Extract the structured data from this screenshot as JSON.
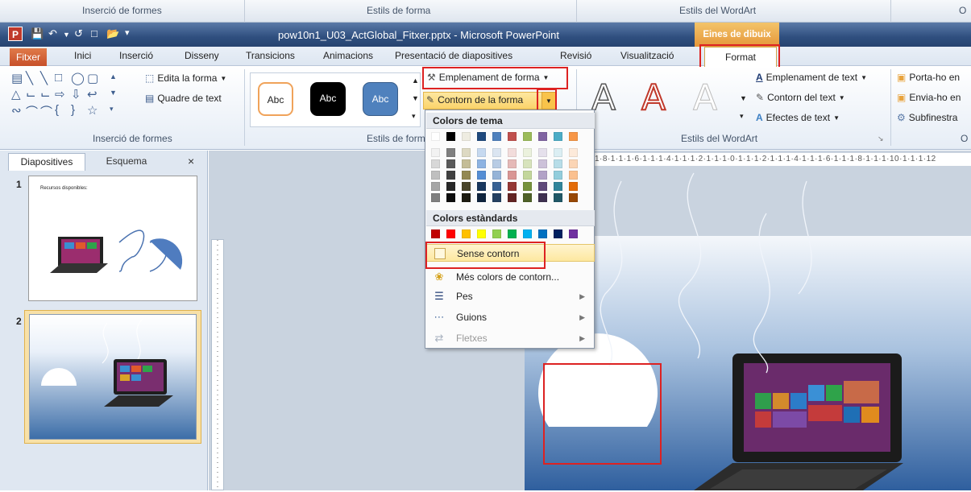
{
  "top_strip": {
    "labels": [
      "Inserció de formes",
      "Estils de forma",
      "Estils del WordArt",
      "O"
    ]
  },
  "title_bar": {
    "title": "pow10n1_U03_ActGlobal_Fitxer.pptx - Microsoft PowerPoint",
    "context_tab": "Eines de dibuix"
  },
  "tabs": [
    "Fitxer",
    "Inici",
    "Inserció",
    "Disseny",
    "Transicions",
    "Animacions",
    "Presentació de diapositives",
    "Revisió",
    "Visualització",
    "Format"
  ],
  "ribbon": {
    "insert_shapes": {
      "edit_shape": "Edita la forma",
      "text_box": "Quadre de text",
      "label": "Inserció de formes"
    },
    "shape_styles": {
      "sample": "Abc",
      "fill": "Emplenament de forma",
      "outline": "Contorn de la forma",
      "label": "Estils de forma"
    },
    "wordart": {
      "letter": "A",
      "text_fill": "Emplenament de text",
      "text_outline": "Contorn del text",
      "text_effects": "Efectes de text",
      "label": "Estils del WordArt"
    },
    "arrange": {
      "bring_forward": "Porta-ho en",
      "send_backward": "Envia-ho en",
      "selection_pane": "Subfinestra",
      "label": "O"
    }
  },
  "left_panel": {
    "tabs": [
      "Diapositives",
      "Esquema"
    ],
    "close": "×",
    "slides": [
      {
        "number": "1",
        "title": "Recursos disponibles:"
      },
      {
        "number": "2"
      }
    ]
  },
  "ruler_top": "1·8·1·1·1·6·1·1·1·4·1·1·1·2·1·1·1·0·1·1·1·2·1·1·1·4·1·1·1·6·1·1·1·8·1·1·1·10·1·1·1·12",
  "menu": {
    "theme_colors_header": "Colors de tema",
    "standard_colors_header": "Colors estàndards",
    "theme_top_row": [
      "#ffffff",
      "#000000",
      "#eeece1",
      "#1f497d",
      "#4f81bd",
      "#c0504d",
      "#9bbb59",
      "#8064a2",
      "#4bacc6",
      "#f79646"
    ],
    "theme_shades": [
      [
        "#f2f2f2",
        "#7f7f7f",
        "#ddd9c3",
        "#c6d9f0",
        "#dbe5f1",
        "#f2dcdb",
        "#ebf1dd",
        "#e5e0ec",
        "#dbeef3",
        "#fdeada"
      ],
      [
        "#d8d8d8",
        "#595959",
        "#c4bd97",
        "#8db3e2",
        "#b8cce4",
        "#e5b9b7",
        "#d7e3bc",
        "#ccc1d9",
        "#b7dde8",
        "#fbd5b5"
      ],
      [
        "#bfbfbf",
        "#3f3f3f",
        "#938953",
        "#548dd4",
        "#95b3d7",
        "#d99694",
        "#c3d69b",
        "#b2a2c7",
        "#92cddc",
        "#fac08f"
      ],
      [
        "#a5a5a5",
        "#262626",
        "#494429",
        "#17365d",
        "#366092",
        "#953734",
        "#76923c",
        "#5f497a",
        "#31859b",
        "#e36c09"
      ],
      [
        "#7f7f7f",
        "#0c0c0c",
        "#1d1b10",
        "#0f243e",
        "#244061",
        "#632423",
        "#4f6128",
        "#3f3151",
        "#205867",
        "#974806"
      ]
    ],
    "standard_colors": [
      "#c00000",
      "#ff0000",
      "#ffc000",
      "#ffff00",
      "#92d050",
      "#00b050",
      "#00b0f0",
      "#0070c0",
      "#002060",
      "#7030a0"
    ],
    "items": [
      {
        "label": "Sense contorn"
      },
      {
        "label": "Més colors de contorn..."
      },
      {
        "label": "Pes"
      },
      {
        "label": "Guions"
      },
      {
        "label": "Fletxes"
      }
    ]
  }
}
